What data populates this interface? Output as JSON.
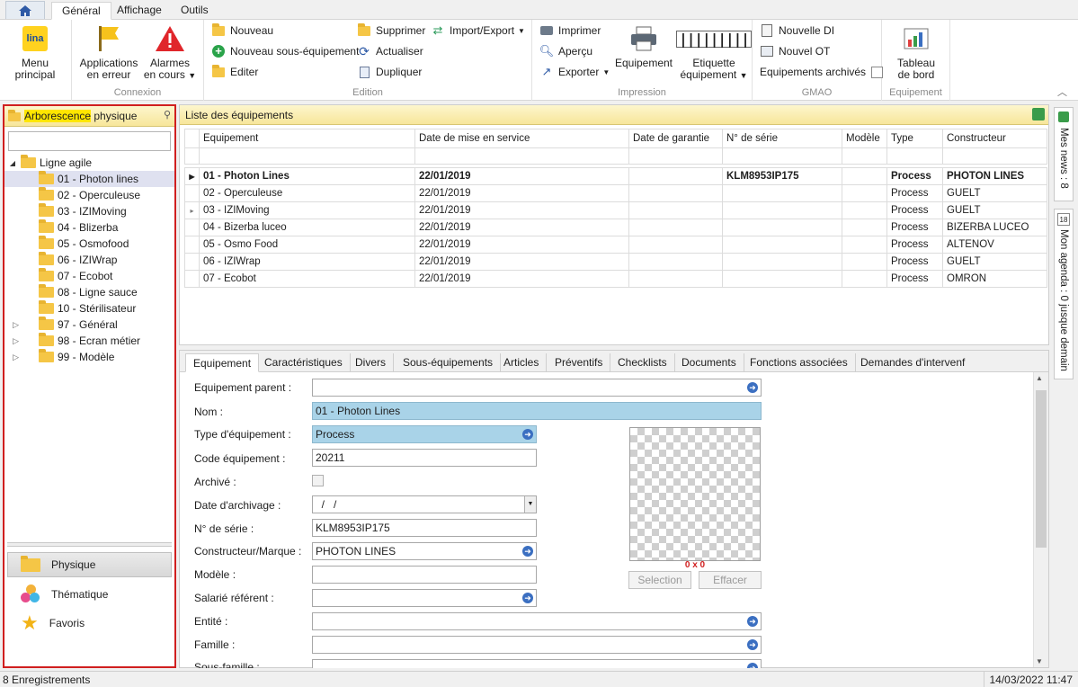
{
  "tabs": {
    "general": "Général",
    "affichage": "Affichage",
    "outils": "Outils"
  },
  "ribbon": {
    "menu_principal": "Menu principal",
    "connexion": {
      "applications_l1": "Applications",
      "applications_l2": "en erreur",
      "alarmes_l1": "Alarmes",
      "alarmes_l2": "en cours",
      "title": "Connexion"
    },
    "edition": {
      "nouveau": "Nouveau",
      "nouveau_sous": "Nouveau sous-équipement",
      "editer": "Editer",
      "supprimer": "Supprimer",
      "actualiser": "Actualiser",
      "dupliquer": "Dupliquer",
      "import_export": "Import/Export",
      "title": "Edition"
    },
    "impression": {
      "imprimer": "Imprimer",
      "apercu": "Aperçu",
      "exporter": "Exporter",
      "equipement": "Equipement",
      "etiquette_l1": "Etiquette",
      "etiquette_l2": "équipement",
      "title": "Impression"
    },
    "gmao": {
      "nouvelle_di": "Nouvelle DI",
      "nouvel_ot": "Nouvel OT",
      "archives": "Equipements archivés",
      "title": "GMAO"
    },
    "equip_grp": {
      "tableau_l1": "Tableau",
      "tableau_l2": "de bord",
      "title": "Equipement"
    },
    "icon_logo": "lina",
    "icon_barcode": "|||||||||"
  },
  "left": {
    "title_hl": "Arborescence",
    "title_rest": " physique",
    "tree_root": "Ligne agile",
    "tree": [
      "01 - Photon lines",
      "02 - Operculeuse",
      "03 - IZIMoving",
      "04 - Blizerba",
      "05 - Osmofood",
      "06 - IZIWrap",
      "07 - Ecobot",
      "08 - Ligne sauce",
      "10 - Stérilisateur",
      "97 - Général",
      "98 - Ecran métier",
      "99 - Modèle"
    ],
    "nav": [
      "Physique",
      "Thématique",
      "Favoris"
    ]
  },
  "list": {
    "title": "Liste des équipements",
    "columns": [
      "Equipement",
      "Date de mise en service",
      "Date de garantie",
      "N° de série",
      "Modèle",
      "Type",
      "Constructeur"
    ],
    "rows": [
      [
        "01 - Photon Lines",
        "22/01/2019",
        "",
        "KLM8953IP175",
        "",
        "Process",
        "PHOTON LINES"
      ],
      [
        "02 - Operculeuse",
        "22/01/2019",
        "",
        "",
        "",
        "Process",
        "GUELT"
      ],
      [
        "03 - IZIMoving",
        "22/01/2019",
        "",
        "",
        "",
        "Process",
        "GUELT"
      ],
      [
        "04 - Bizerba luceo",
        "22/01/2019",
        "",
        "",
        "",
        "Process",
        "BIZERBA LUCEO"
      ],
      [
        "05 - Osmo Food",
        "22/01/2019",
        "",
        "",
        "",
        "Process",
        "ALTENOV"
      ],
      [
        "06 - IZIWrap",
        "22/01/2019",
        "",
        "",
        "",
        "Process",
        "GUELT"
      ],
      [
        "07 - Ecobot",
        "22/01/2019",
        "",
        "",
        "",
        "Process",
        "OMRON"
      ]
    ]
  },
  "detail": {
    "tabs": [
      "Equipement",
      "Caractéristiques",
      "Divers",
      "Sous-équipements",
      "Articles",
      "Préventifs",
      "Checklists",
      "Documents",
      "Fonctions associées",
      "Demandes d'intervenf"
    ],
    "labels": {
      "parent": "Equipement parent :",
      "nom": "Nom :",
      "type": "Type d'équipement :",
      "code": "Code équipement :",
      "archive": "Archivé :",
      "date_arch": "Date d'archivage :",
      "serie": "N° de série :",
      "constructeur": "Constructeur/Marque :",
      "modele": "Modèle :",
      "salarie": "Salarié référent :",
      "entite": "Entité :",
      "famille": "Famille :",
      "sousfamille": "Sous-famille :"
    },
    "values": {
      "parent": "",
      "nom": "01 - Photon Lines",
      "type": "Process",
      "code": "20211",
      "date_arch": "  /   /",
      "serie": "KLM8953IP175",
      "constructeur": "PHOTON LINES"
    },
    "image_size": "0 x 0",
    "btn_selection": "Selection",
    "btn_effacer": "Effacer"
  },
  "rightbar": {
    "news": "Mes news : 8",
    "agenda": "Mon agenda : 0 jusque demain",
    "agenda_badge": "18"
  },
  "status": {
    "count": "8 Enregistrements",
    "datetime": "14/03/2022 11:47"
  },
  "colors": {
    "accent_yellow": "#f7e69a",
    "highlight": "#ffe600",
    "selection": "#dfe1f0",
    "field_blue": "#a9d3e8",
    "red_border": "#d01f1f"
  }
}
